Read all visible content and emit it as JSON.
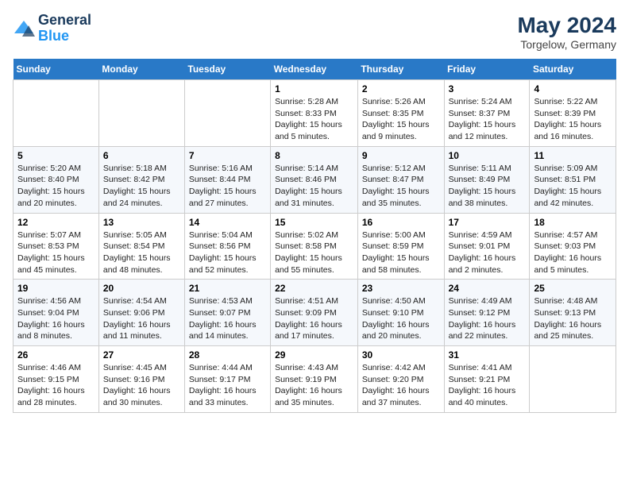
{
  "header": {
    "logo_general": "General",
    "logo_blue": "Blue",
    "month_year": "May 2024",
    "location": "Torgelow, Germany"
  },
  "days_of_week": [
    "Sunday",
    "Monday",
    "Tuesday",
    "Wednesday",
    "Thursday",
    "Friday",
    "Saturday"
  ],
  "weeks": [
    [
      {
        "day": "",
        "info": ""
      },
      {
        "day": "",
        "info": ""
      },
      {
        "day": "",
        "info": ""
      },
      {
        "day": "1",
        "info": "Sunrise: 5:28 AM\nSunset: 8:33 PM\nDaylight: 15 hours\nand 5 minutes."
      },
      {
        "day": "2",
        "info": "Sunrise: 5:26 AM\nSunset: 8:35 PM\nDaylight: 15 hours\nand 9 minutes."
      },
      {
        "day": "3",
        "info": "Sunrise: 5:24 AM\nSunset: 8:37 PM\nDaylight: 15 hours\nand 12 minutes."
      },
      {
        "day": "4",
        "info": "Sunrise: 5:22 AM\nSunset: 8:39 PM\nDaylight: 15 hours\nand 16 minutes."
      }
    ],
    [
      {
        "day": "5",
        "info": "Sunrise: 5:20 AM\nSunset: 8:40 PM\nDaylight: 15 hours\nand 20 minutes."
      },
      {
        "day": "6",
        "info": "Sunrise: 5:18 AM\nSunset: 8:42 PM\nDaylight: 15 hours\nand 24 minutes."
      },
      {
        "day": "7",
        "info": "Sunrise: 5:16 AM\nSunset: 8:44 PM\nDaylight: 15 hours\nand 27 minutes."
      },
      {
        "day": "8",
        "info": "Sunrise: 5:14 AM\nSunset: 8:46 PM\nDaylight: 15 hours\nand 31 minutes."
      },
      {
        "day": "9",
        "info": "Sunrise: 5:12 AM\nSunset: 8:47 PM\nDaylight: 15 hours\nand 35 minutes."
      },
      {
        "day": "10",
        "info": "Sunrise: 5:11 AM\nSunset: 8:49 PM\nDaylight: 15 hours\nand 38 minutes."
      },
      {
        "day": "11",
        "info": "Sunrise: 5:09 AM\nSunset: 8:51 PM\nDaylight: 15 hours\nand 42 minutes."
      }
    ],
    [
      {
        "day": "12",
        "info": "Sunrise: 5:07 AM\nSunset: 8:53 PM\nDaylight: 15 hours\nand 45 minutes."
      },
      {
        "day": "13",
        "info": "Sunrise: 5:05 AM\nSunset: 8:54 PM\nDaylight: 15 hours\nand 48 minutes."
      },
      {
        "day": "14",
        "info": "Sunrise: 5:04 AM\nSunset: 8:56 PM\nDaylight: 15 hours\nand 52 minutes."
      },
      {
        "day": "15",
        "info": "Sunrise: 5:02 AM\nSunset: 8:58 PM\nDaylight: 15 hours\nand 55 minutes."
      },
      {
        "day": "16",
        "info": "Sunrise: 5:00 AM\nSunset: 8:59 PM\nDaylight: 15 hours\nand 58 minutes."
      },
      {
        "day": "17",
        "info": "Sunrise: 4:59 AM\nSunset: 9:01 PM\nDaylight: 16 hours\nand 2 minutes."
      },
      {
        "day": "18",
        "info": "Sunrise: 4:57 AM\nSunset: 9:03 PM\nDaylight: 16 hours\nand 5 minutes."
      }
    ],
    [
      {
        "day": "19",
        "info": "Sunrise: 4:56 AM\nSunset: 9:04 PM\nDaylight: 16 hours\nand 8 minutes."
      },
      {
        "day": "20",
        "info": "Sunrise: 4:54 AM\nSunset: 9:06 PM\nDaylight: 16 hours\nand 11 minutes."
      },
      {
        "day": "21",
        "info": "Sunrise: 4:53 AM\nSunset: 9:07 PM\nDaylight: 16 hours\nand 14 minutes."
      },
      {
        "day": "22",
        "info": "Sunrise: 4:51 AM\nSunset: 9:09 PM\nDaylight: 16 hours\nand 17 minutes."
      },
      {
        "day": "23",
        "info": "Sunrise: 4:50 AM\nSunset: 9:10 PM\nDaylight: 16 hours\nand 20 minutes."
      },
      {
        "day": "24",
        "info": "Sunrise: 4:49 AM\nSunset: 9:12 PM\nDaylight: 16 hours\nand 22 minutes."
      },
      {
        "day": "25",
        "info": "Sunrise: 4:48 AM\nSunset: 9:13 PM\nDaylight: 16 hours\nand 25 minutes."
      }
    ],
    [
      {
        "day": "26",
        "info": "Sunrise: 4:46 AM\nSunset: 9:15 PM\nDaylight: 16 hours\nand 28 minutes."
      },
      {
        "day": "27",
        "info": "Sunrise: 4:45 AM\nSunset: 9:16 PM\nDaylight: 16 hours\nand 30 minutes."
      },
      {
        "day": "28",
        "info": "Sunrise: 4:44 AM\nSunset: 9:17 PM\nDaylight: 16 hours\nand 33 minutes."
      },
      {
        "day": "29",
        "info": "Sunrise: 4:43 AM\nSunset: 9:19 PM\nDaylight: 16 hours\nand 35 minutes."
      },
      {
        "day": "30",
        "info": "Sunrise: 4:42 AM\nSunset: 9:20 PM\nDaylight: 16 hours\nand 37 minutes."
      },
      {
        "day": "31",
        "info": "Sunrise: 4:41 AM\nSunset: 9:21 PM\nDaylight: 16 hours\nand 40 minutes."
      },
      {
        "day": "",
        "info": ""
      }
    ]
  ]
}
